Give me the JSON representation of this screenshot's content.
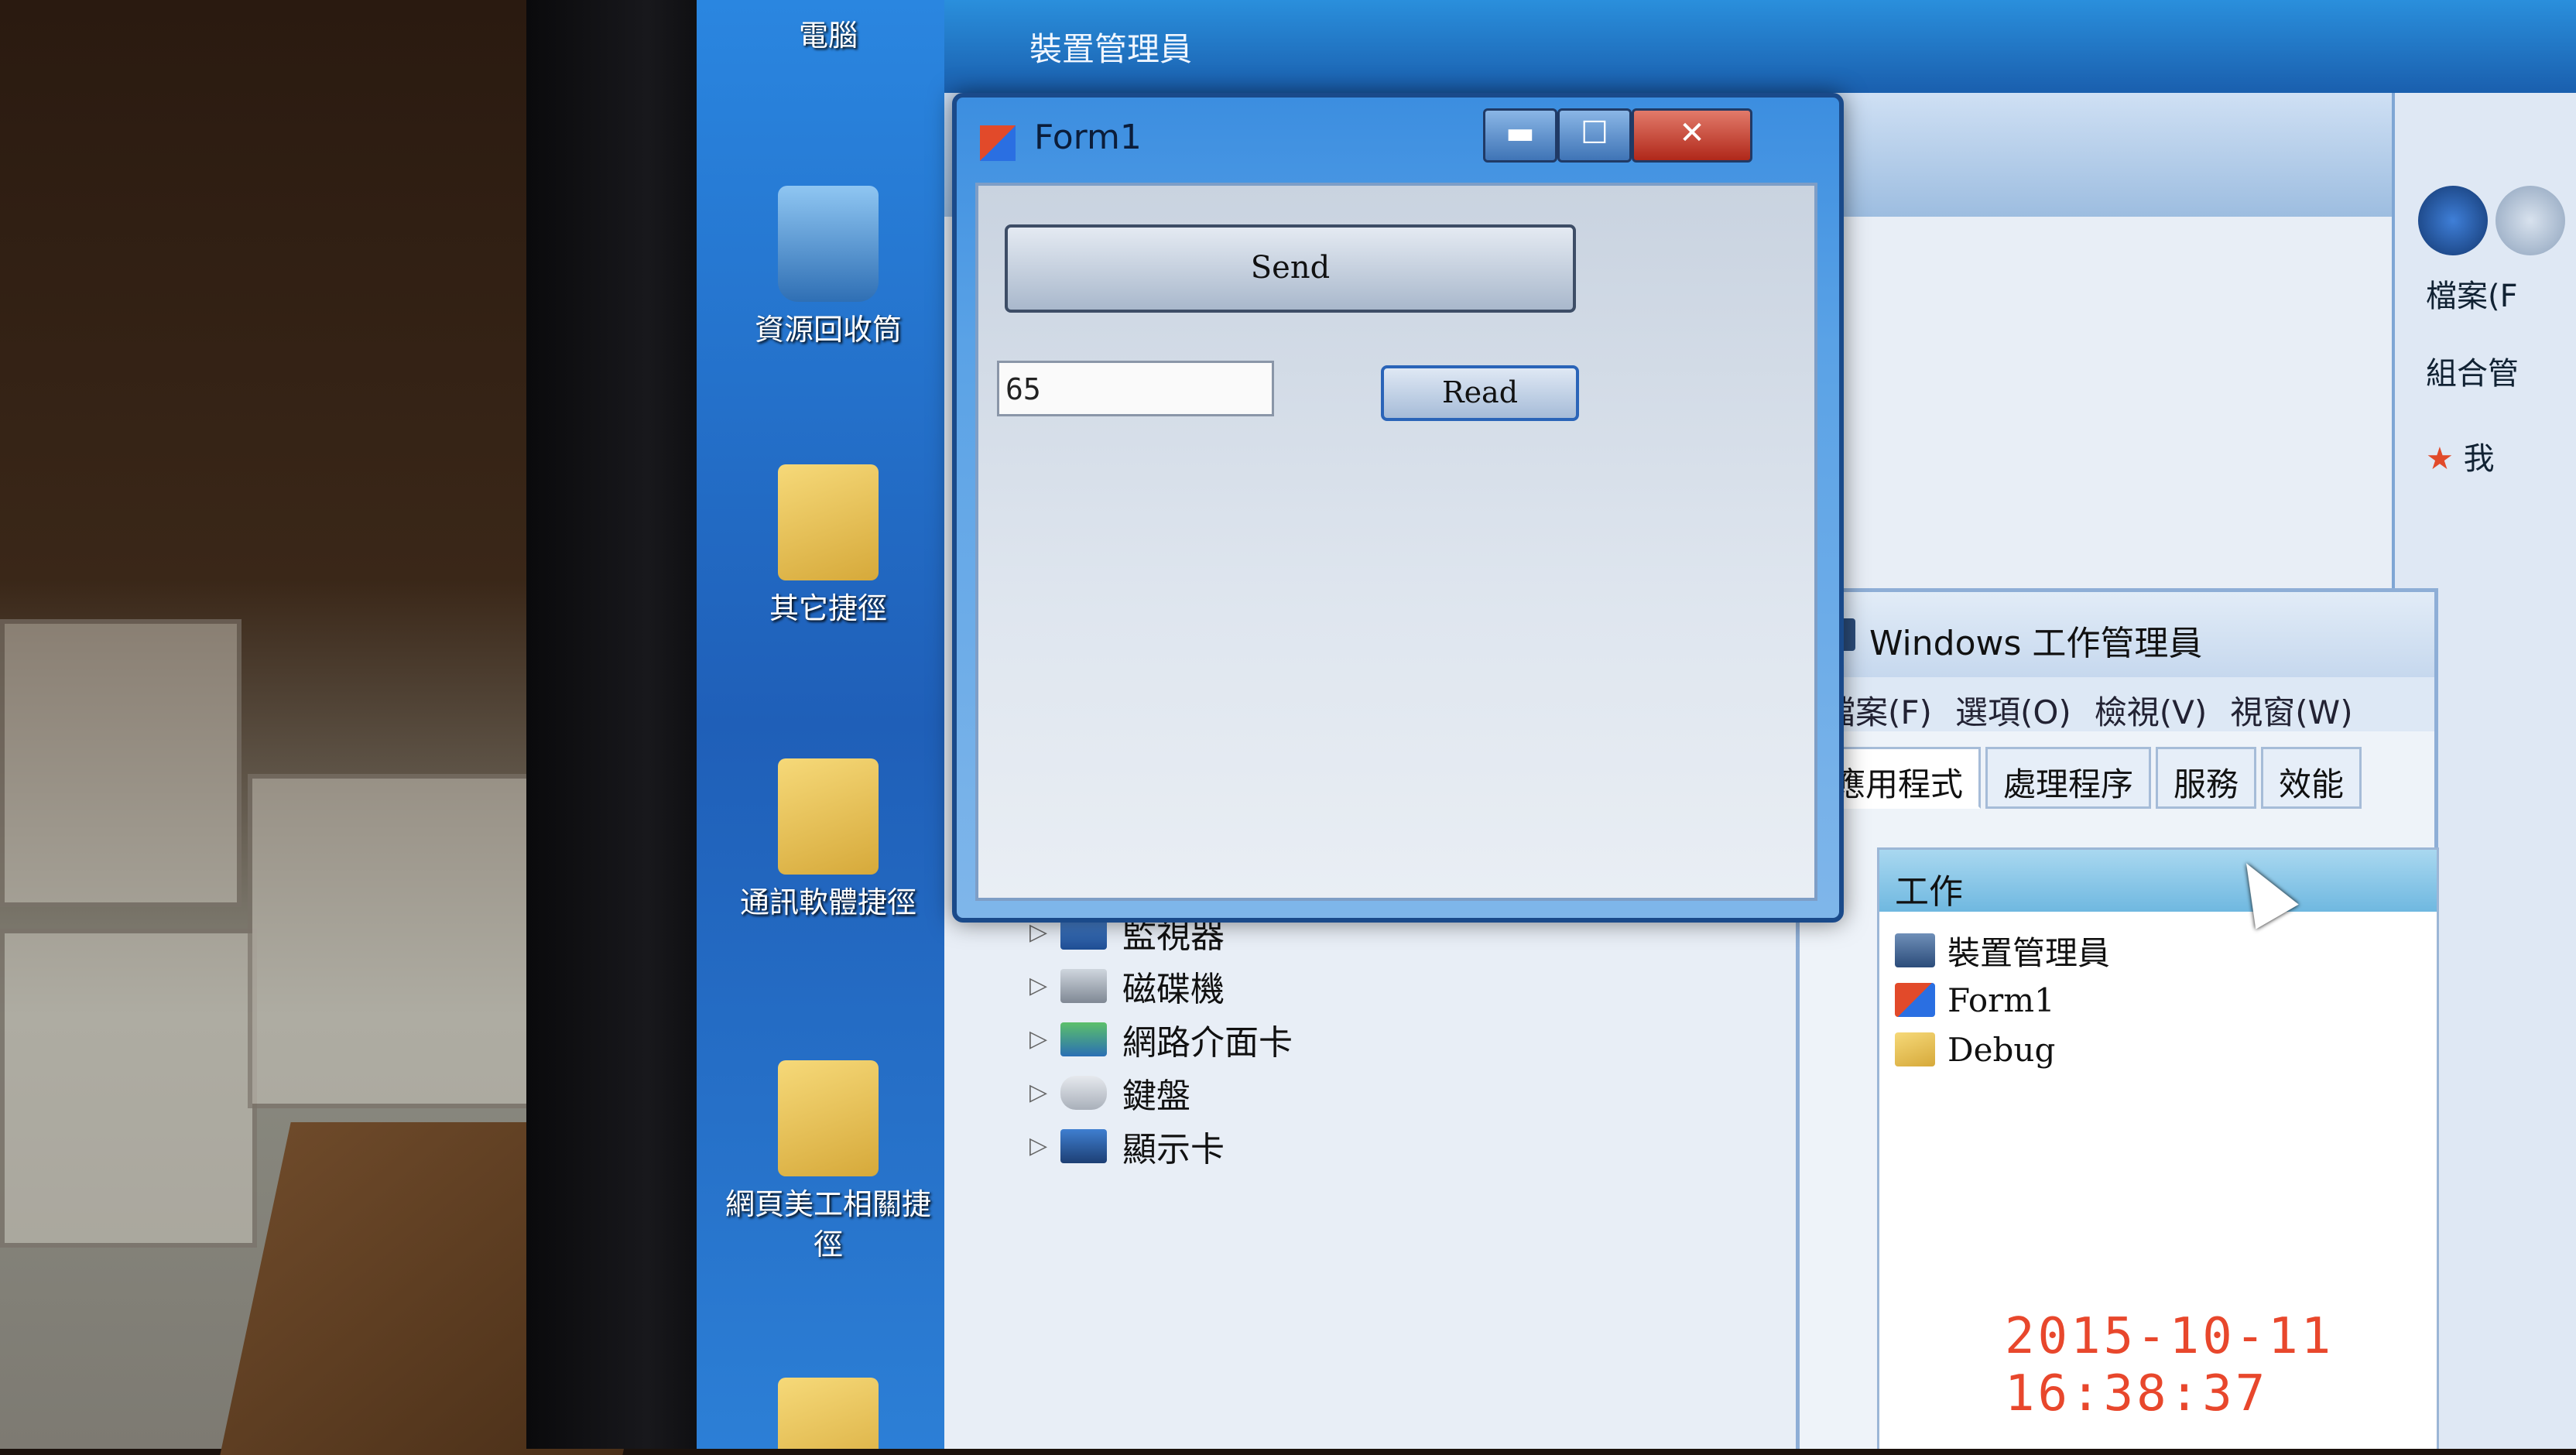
{
  "desktop": {
    "icons": [
      {
        "label": "電腦"
      },
      {
        "label": "資源回收筒"
      },
      {
        "label": "其它捷徑"
      },
      {
        "label": "通訊軟體捷徑"
      },
      {
        "label": "網頁美工相關捷徑"
      }
    ]
  },
  "device_manager": {
    "title": "裝置管理員",
    "tree": [
      {
        "label": "監視器"
      },
      {
        "label": "磁碟機"
      },
      {
        "label": "網路介面卡"
      },
      {
        "label": "鍵盤"
      },
      {
        "label": "顯示卡"
      }
    ]
  },
  "explorer": {
    "menu_file": "檔案(F",
    "organize": "組合管",
    "fav_first_char": "我"
  },
  "task_manager": {
    "title": "Windows 工作管理員",
    "menu": [
      "檔案(F)",
      "選項(O)",
      "檢視(V)",
      "視窗(W)"
    ],
    "tabs": [
      "應用程式",
      "處理程序",
      "服務",
      "效能"
    ],
    "active_tab": "應用程式",
    "column_header": "工作",
    "tasks": [
      {
        "name": "裝置管理員",
        "icon": "device-manager-icon"
      },
      {
        "name": "Form1",
        "icon": "form-icon"
      },
      {
        "name": "Debug",
        "icon": "folder-icon"
      }
    ]
  },
  "form1": {
    "title": "Form1",
    "send_label": "Send",
    "read_label": "Read",
    "value": "65",
    "controls": {
      "minimize": "▬",
      "maximize": "☐",
      "close": "✕"
    }
  },
  "photo_timestamp": "2015-10-11 16:38:37"
}
